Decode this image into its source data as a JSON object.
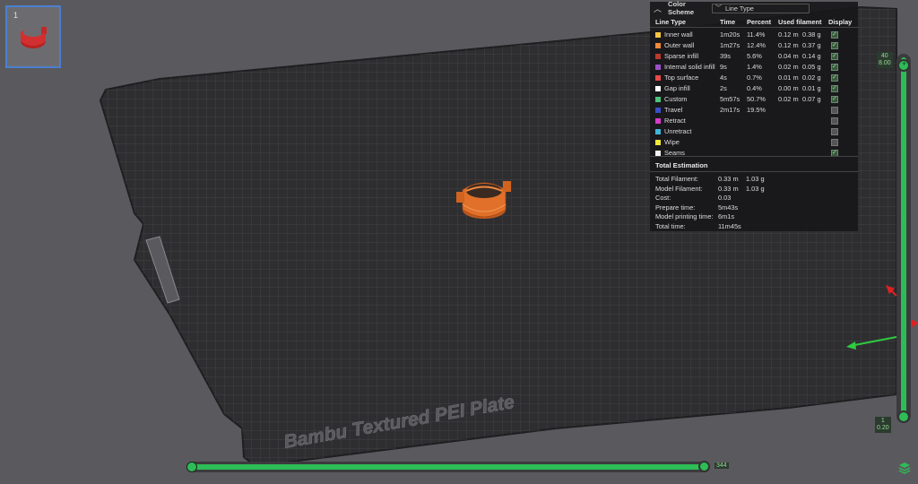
{
  "plate_name": "Bambu Textured PEI Plate",
  "thumbnail": {
    "index": "1"
  },
  "panel": {
    "color_scheme_label": "Color Scheme",
    "color_scheme_value": "Line Type",
    "headers": {
      "line_type": "Line Type",
      "time": "Time",
      "percent": "Percent",
      "used_filament": "Used filament",
      "display": "Display"
    },
    "rows": [
      {
        "name": "Inner wall",
        "color": "#f5c542",
        "time": "1m20s",
        "percent": "11.4%",
        "len": "0.12 m",
        "weight": "0.38 g",
        "checked": true
      },
      {
        "name": "Outer wall",
        "color": "#f08a3a",
        "time": "1m27s",
        "percent": "12.4%",
        "len": "0.12 m",
        "weight": "0.37 g",
        "checked": true
      },
      {
        "name": "Sparse infill",
        "color": "#b83a2c",
        "time": "39s",
        "percent": "5.6%",
        "len": "0.04 m",
        "weight": "0.14 g",
        "checked": true
      },
      {
        "name": "Internal solid infill",
        "color": "#9a4fc8",
        "time": "9s",
        "percent": "1.4%",
        "len": "0.02 m",
        "weight": "0.05 g",
        "checked": true
      },
      {
        "name": "Top surface",
        "color": "#e84a4a",
        "time": "4s",
        "percent": "0.7%",
        "len": "0.01 m",
        "weight": "0.02 g",
        "checked": true
      },
      {
        "name": "Gap infill",
        "color": "#ffffff",
        "time": "2s",
        "percent": "0.4%",
        "len": "0.00 m",
        "weight": "0.01 g",
        "checked": true
      },
      {
        "name": "Custom",
        "color": "#4cc47a",
        "time": "5m57s",
        "percent": "50.7%",
        "len": "0.02 m",
        "weight": "0.07 g",
        "checked": true
      },
      {
        "name": "Travel",
        "color": "#3a4ec8",
        "time": "2m17s",
        "percent": "19.5%",
        "len": "",
        "weight": "",
        "checked": false
      },
      {
        "name": "Retract",
        "color": "#d63cc8",
        "time": "",
        "percent": "",
        "len": "",
        "weight": "",
        "checked": false
      },
      {
        "name": "Unretract",
        "color": "#3fb4d8",
        "time": "",
        "percent": "",
        "len": "",
        "weight": "",
        "checked": false
      },
      {
        "name": "Wipe",
        "color": "#f2e83a",
        "time": "",
        "percent": "",
        "len": "",
        "weight": "",
        "checked": false
      },
      {
        "name": "Seams",
        "color": "#f2f2f2",
        "time": "",
        "percent": "",
        "len": "",
        "weight": "",
        "checked": true
      }
    ],
    "total_title": "Total Estimation",
    "estimation": [
      {
        "label": "Total Filament:",
        "v1": "0.33 m",
        "v2": "1.03 g"
      },
      {
        "label": "Model Filament:",
        "v1": "0.33 m",
        "v2": "1.03 g"
      },
      {
        "label": "Cost:",
        "v1": "0.03",
        "v2": ""
      },
      {
        "label": "Prepare time:",
        "v1": "5m43s",
        "v2": ""
      },
      {
        "label": "Model printing time:",
        "v1": "6m1s",
        "v2": ""
      },
      {
        "label": "Total time:",
        "v1": "11m45s",
        "v2": ""
      }
    ]
  },
  "horizontal_slider": {
    "value": "344"
  },
  "vertical_slider": {
    "top_layer": "40",
    "top_height": "8.00",
    "bottom_layer": "1",
    "bottom_height": "0.20"
  },
  "colors": {
    "accent": "#2dbd56",
    "model": "#e0702a",
    "plate": "#2e2e31"
  }
}
